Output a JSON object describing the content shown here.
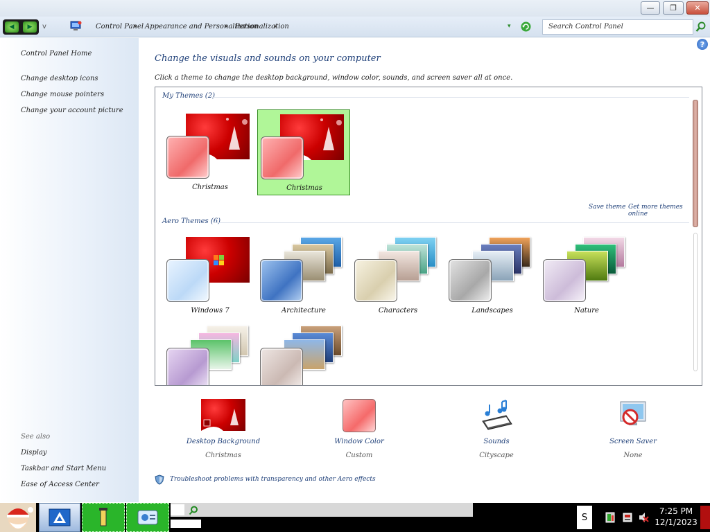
{
  "window": {
    "minimize_label": "—",
    "maximize_label": "❐",
    "close_label": "✕"
  },
  "navbar": {
    "back_icon": "back-arrow-icon",
    "forward_icon": "forward-arrow-icon",
    "recent_label": "v",
    "breadcrumbs": [
      "Control Panel",
      "Appearance and Personalization",
      "Personalization"
    ],
    "separator": "▸",
    "dropdown_label": "▾",
    "search_placeholder": "Search Control Panel"
  },
  "left_pane": {
    "home": "Control Panel Home",
    "links": [
      "Change desktop icons",
      "Change mouse pointers",
      "Change your account picture"
    ],
    "see_also_title": "See also",
    "see_also": [
      "Display",
      "Taskbar and Start Menu",
      "Ease of Access Center"
    ]
  },
  "help_label": "?",
  "main": {
    "heading": "Change the visuals and sounds on your computer",
    "subtitle": "Click a theme to change the desktop background, window color, sounds, and screen saver all at once.",
    "my_themes_title": "My Themes (2)",
    "aero_themes_title": "Aero Themes (6)",
    "save_theme": "Save theme",
    "get_more_themes": "Get more themes online",
    "my_themes": [
      {
        "name": "Christmas",
        "selected": false
      },
      {
        "name": "Christmas",
        "selected": true
      }
    ],
    "aero_themes": [
      {
        "name": "Windows 7"
      },
      {
        "name": "Architecture"
      },
      {
        "name": "Characters"
      },
      {
        "name": "Landscapes"
      },
      {
        "name": "Nature"
      },
      {
        "name": ""
      },
      {
        "name": ""
      }
    ],
    "settings": [
      {
        "label": "Desktop Background",
        "value": "Christmas",
        "icon": "desktop-background-icon"
      },
      {
        "label": "Window Color",
        "value": "Custom",
        "icon": "window-color-icon"
      },
      {
        "label": "Sounds",
        "value": "Cityscape",
        "icon": "sounds-icon"
      },
      {
        "label": "Screen Saver",
        "value": "None",
        "icon": "screen-saver-icon"
      }
    ],
    "troubleshoot": "Troubleshoot problems with transparency and other Aero effects"
  },
  "taskbar": {
    "s_label": "S",
    "time": "7:25 PM",
    "date": "12/1/2023"
  },
  "colors": {
    "link_blue": "#1e3f78",
    "selected_green": "#b0f698",
    "christmas_red": "#c00000",
    "taskbar_green": "#2ab52a"
  }
}
